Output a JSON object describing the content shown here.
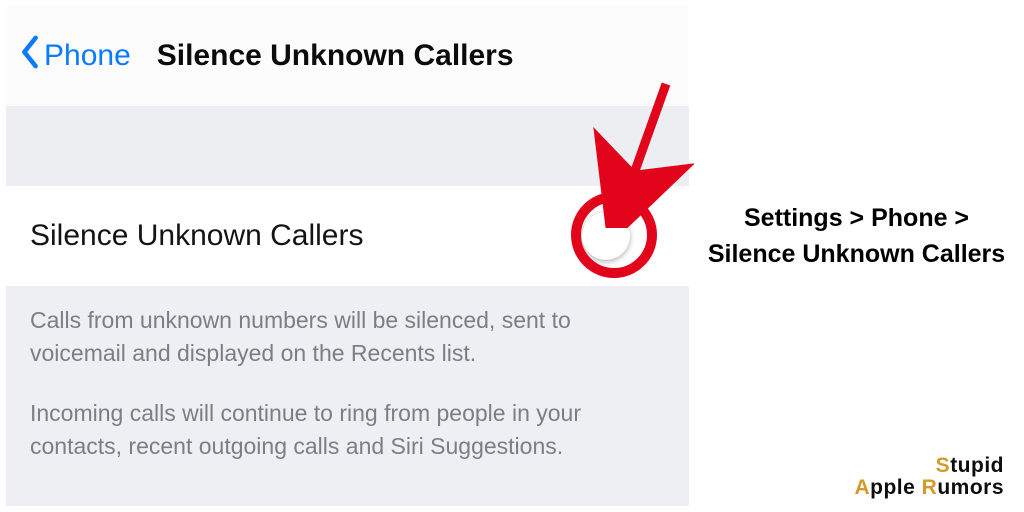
{
  "nav": {
    "back_label": "Phone",
    "title": "Silence Unknown Callers"
  },
  "setting": {
    "label": "Silence Unknown Callers",
    "toggle_state": "off"
  },
  "footer": {
    "p1": "Calls from unknown numbers will be silenced, sent to voicemail and displayed on the Recents list.",
    "p2": "Incoming calls will continue to ring from people in your contacts, recent outgoing calls and Siri Suggestions."
  },
  "annotation": {
    "highlight_color": "#e2041b",
    "arrow_color": "#e2041b"
  },
  "caption": {
    "text": "Settings > Phone > Silence Unknown Callers"
  },
  "watermark": {
    "line1_s": "S",
    "line1_rest": "tupid",
    "line2_a": "A",
    "line2_mid": "pple ",
    "line2_r": "R",
    "line2_rest": "umors"
  }
}
